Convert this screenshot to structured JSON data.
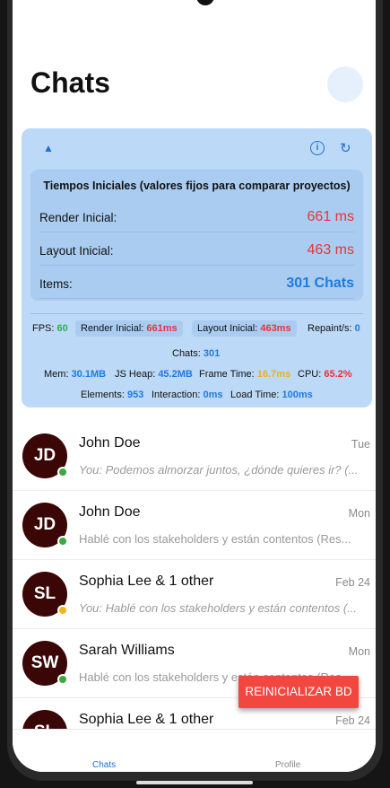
{
  "header": {
    "title": "Chats"
  },
  "panel": {
    "collapse_icon": "triangle-up",
    "info_icon": "info",
    "refresh_icon": "refresh",
    "title": "Tiempos Iniciales (valores fijos para comparar proyectos)",
    "rows": [
      {
        "label": "Render Inicial:",
        "value": "661 ms"
      },
      {
        "label": "Layout Inicial:",
        "value": "463 ms"
      },
      {
        "label": "Items:",
        "value": "301 Chats"
      }
    ],
    "stats": {
      "fps_label": "FPS:",
      "fps_value": "60",
      "render_label": "Render Inicial:",
      "render_value": "661ms",
      "layout_label": "Layout Inicial:",
      "layout_value": "463ms",
      "repaint_label": "Repaint/s:",
      "repaint_value": "0",
      "chats_label": "Chats:",
      "chats_value": "301",
      "mem_label": "Mem:",
      "mem_value": "30.1MB",
      "heap_label": "JS Heap:",
      "heap_value": "45.2MB",
      "frame_label": "Frame Time:",
      "frame_value": "16.7ms",
      "cpu_label": "CPU:",
      "cpu_value": "65.2%",
      "elements_label": "Elements:",
      "elements_value": "953",
      "interaction_label": "Interaction:",
      "interaction_value": "0ms",
      "load_label": "Load Time:",
      "load_value": "100ms"
    }
  },
  "chats": [
    {
      "initials": "JD",
      "name": "John Doe",
      "time": "Tue",
      "message": "You: Podemos almorzar juntos, ¿dónde quieres ir? (...",
      "status_color": "#3aa845"
    },
    {
      "initials": "JD",
      "name": "John Doe",
      "time": "Mon",
      "message": "Hablé con los stakeholders y están contentos (Res...",
      "status_color": "#3aa845"
    },
    {
      "initials": "SL",
      "name": "Sophia Lee & 1 other",
      "time": "Feb 24",
      "message": "You: Hablé con los stakeholders y están contentos (...",
      "status_color": "#f2b713"
    },
    {
      "initials": "SW",
      "name": "Sarah Williams",
      "time": "Mon",
      "message": "Hablé con los stakeholders y están contentos (Res...",
      "status_color": "#3aa845"
    },
    {
      "initials": "SL",
      "name": "Sophia Lee & 1 other",
      "time": "Feb 24",
      "message": "",
      "status_color": "#f2b713"
    }
  ],
  "fab": {
    "label": "REINICIALIZAR BD"
  },
  "tabs": [
    {
      "label": "Chats",
      "active": true
    },
    {
      "label": "Profile",
      "active": false
    }
  ]
}
